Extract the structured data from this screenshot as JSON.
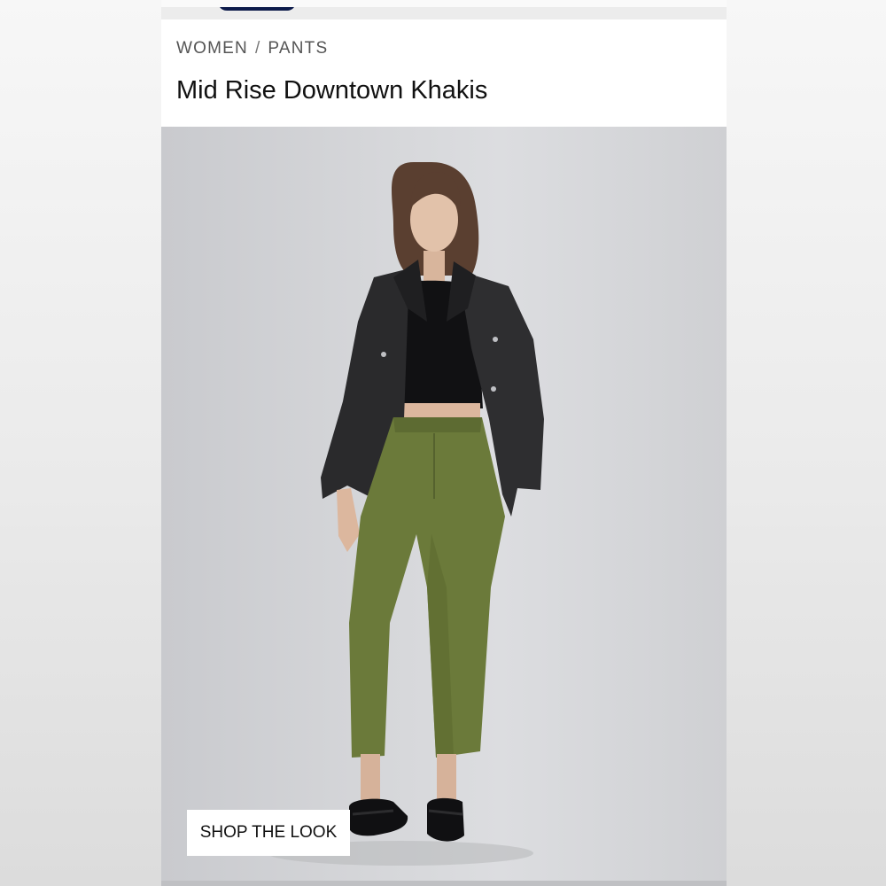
{
  "breadcrumb": {
    "items": [
      "WOMEN",
      "PANTS"
    ],
    "separator": "/"
  },
  "product": {
    "title": "Mid Rise Downtown Khakis"
  },
  "hero": {
    "image_description_icon": "model-photo",
    "cta_label": "SHOP THE LOOK"
  },
  "colors": {
    "brand_navy": "#0c1a4a",
    "pants_olive": "#6b7a3a",
    "jacket_black": "#2a2a2c",
    "background_gray": "#d6d7da"
  }
}
